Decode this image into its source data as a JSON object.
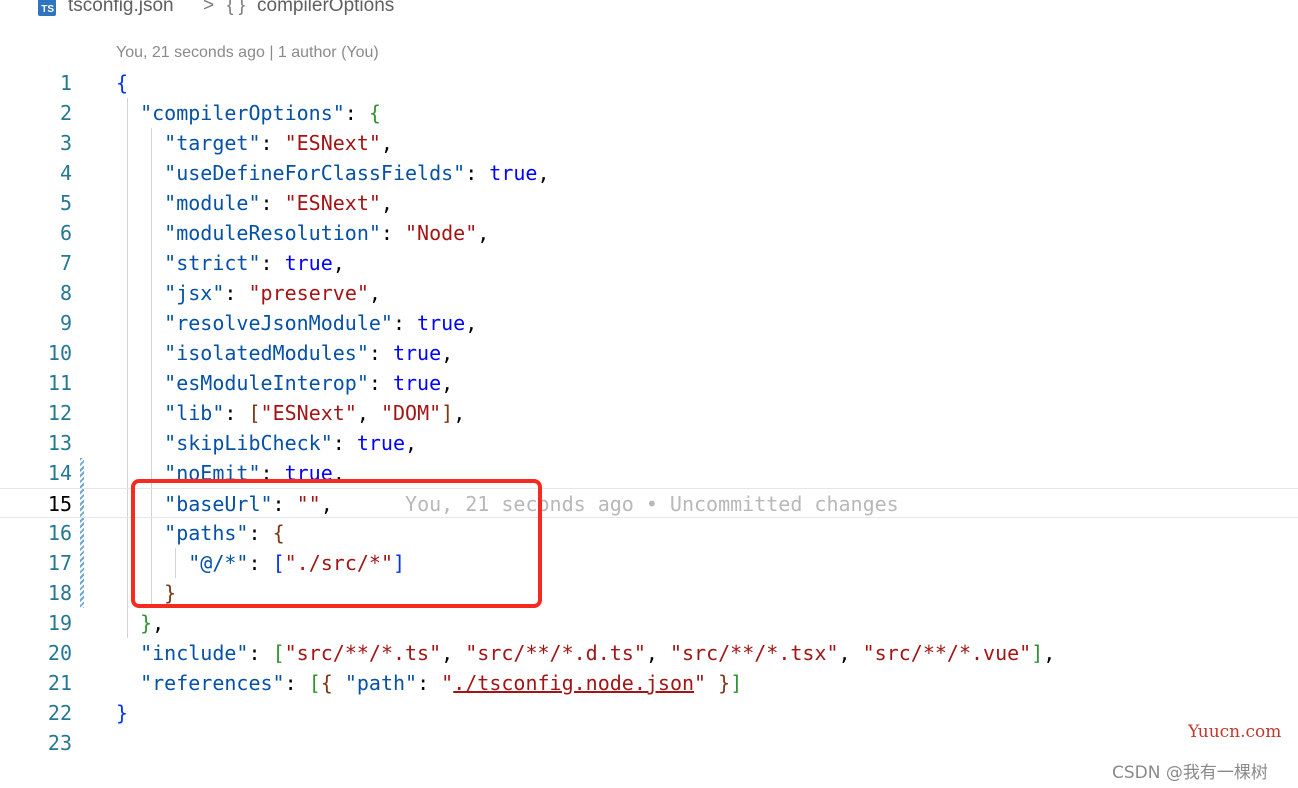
{
  "breadcrumb": {
    "file_icon": "TS",
    "file_name": "tsconfig.json",
    "separator": ">",
    "symbol_icon": "{ }",
    "symbol_name": "compilerOptions"
  },
  "blame_header": "You, 21 seconds ago | 1 author (You)",
  "inline_blame": "You, 21 seconds ago • Uncommitted changes",
  "current_line": 15,
  "line_numbers": [
    "1",
    "2",
    "3",
    "4",
    "5",
    "6",
    "7",
    "8",
    "9",
    "10",
    "11",
    "12",
    "13",
    "14",
    "15",
    "16",
    "17",
    "18",
    "19",
    "20",
    "21",
    "22",
    "23"
  ],
  "colors": {
    "key": "#0451a5",
    "string": "#a31515",
    "boolean": "#0000ff",
    "highlight_box": "#f52b20"
  },
  "code": {
    "l1_open": "{",
    "l2_key": "\"compilerOptions\"",
    "l3_key": "\"target\"",
    "l3_val": "\"ESNext\"",
    "l4_key": "\"useDefineForClassFields\"",
    "l4_val": "true",
    "l5_key": "\"module\"",
    "l5_val": "\"ESNext\"",
    "l6_key": "\"moduleResolution\"",
    "l6_val": "\"Node\"",
    "l7_key": "\"strict\"",
    "l7_val": "true",
    "l8_key": "\"jsx\"",
    "l8_val": "\"preserve\"",
    "l9_key": "\"resolveJsonModule\"",
    "l9_val": "true",
    "l10_key": "\"isolatedModules\"",
    "l10_val": "true",
    "l11_key": "\"esModuleInterop\"",
    "l11_val": "true",
    "l12_key": "\"lib\"",
    "l12_v1": "\"ESNext\"",
    "l12_v2": "\"DOM\"",
    "l13_key": "\"skipLibCheck\"",
    "l13_val": "true",
    "l14_key": "\"noEmit\"",
    "l14_val": "true",
    "l15_key": "\"baseUrl\"",
    "l15_val": "\"\"",
    "l16_key": "\"paths\"",
    "l17_key": "\"@/*\"",
    "l17_val": "\"./src/*\"",
    "l20_key": "\"include\"",
    "l20_v1": "\"src/**/*.ts\"",
    "l20_v2": "\"src/**/*.d.ts\"",
    "l20_v3": "\"src/**/*.tsx\"",
    "l20_v4": "\"src/**/*.vue\"",
    "l21_key": "\"references\"",
    "l21_k2": "\"path\"",
    "l21_v_quote": "\"",
    "l21_v_link": "./tsconfig.node.json",
    "l21_v_end": "\"",
    "l22_close": "}"
  },
  "watermarks": {
    "site": "Yuucn.com",
    "author": "CSDN @我有一棵树"
  }
}
